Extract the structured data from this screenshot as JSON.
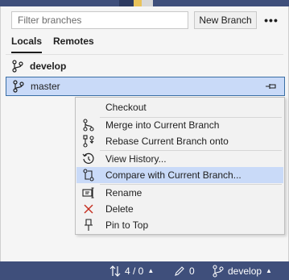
{
  "filter": {
    "placeholder": "Filter branches"
  },
  "toolbar": {
    "new_branch_label": "New Branch",
    "more_label": "•••"
  },
  "tabs": [
    {
      "label": "Locals",
      "active": true
    },
    {
      "label": "Remotes",
      "active": false
    }
  ],
  "branches": [
    {
      "name": "develop",
      "bold": true,
      "selected": false
    },
    {
      "name": "master",
      "bold": false,
      "selected": true
    }
  ],
  "context_menu": {
    "items": [
      {
        "label": "Checkout",
        "icon": "none"
      },
      {
        "label": "Merge into Current Branch",
        "icon": "merge-icon"
      },
      {
        "label": "Rebase Current Branch onto",
        "icon": "rebase-icon"
      },
      {
        "label": "View History...",
        "icon": "history-icon"
      },
      {
        "label": "Compare with Current Branch...",
        "icon": "compare-icon",
        "highlighted": true
      },
      {
        "label": "Rename",
        "icon": "rename-icon"
      },
      {
        "label": "Delete",
        "icon": "delete-icon"
      },
      {
        "label": "Pin to Top",
        "icon": "pin-icon"
      }
    ]
  },
  "status_bar": {
    "sync": "4 / 0",
    "edits": "0",
    "branch": "develop"
  },
  "colors": {
    "status_bar": "#3f4f7b",
    "selection": "#c9daf8",
    "accent_border": "#3a6ea5",
    "delete_red": "#c42b1c"
  }
}
